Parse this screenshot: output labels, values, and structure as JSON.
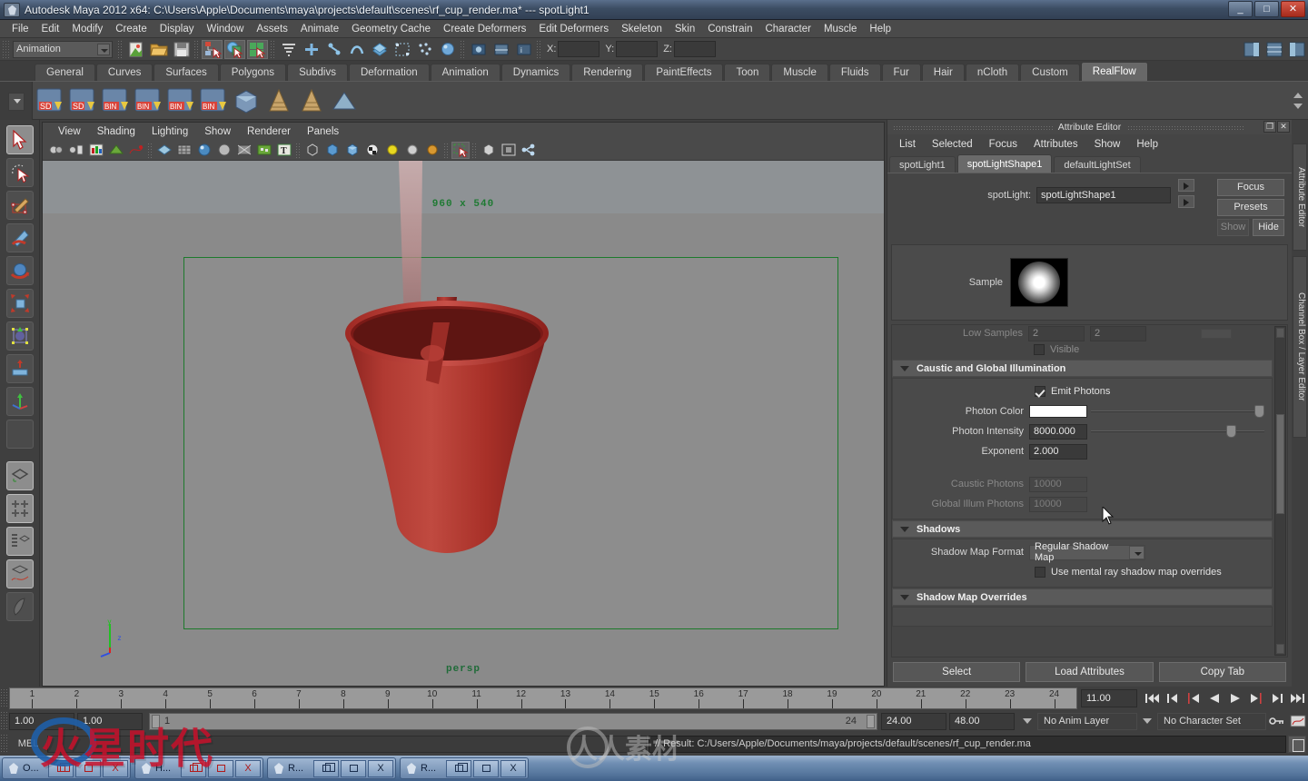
{
  "window": {
    "title": "Autodesk Maya 2012 x64: C:\\Users\\Apple\\Documents\\maya\\projects\\default\\scenes\\rf_cup_render.ma*   ---   spotLight1",
    "minimize": "_",
    "maximize": "□",
    "close": "✕"
  },
  "menubar": [
    "File",
    "Edit",
    "Modify",
    "Create",
    "Display",
    "Window",
    "Assets",
    "Animate",
    "Geometry Cache",
    "Create Deformers",
    "Edit Deformers",
    "Skeleton",
    "Skin",
    "Constrain",
    "Character",
    "Muscle",
    "Help"
  ],
  "statusline": {
    "menu_set": "Animation",
    "coord_x": "X:",
    "coord_y": "Y:",
    "coord_z": "Z:",
    "x_value": "",
    "y_value": "",
    "z_value": ""
  },
  "shelf": {
    "tabs": [
      "General",
      "Curves",
      "Surfaces",
      "Polygons",
      "Subdivs",
      "Deformation",
      "Animation",
      "Dynamics",
      "Rendering",
      "PaintEffects",
      "Toon",
      "Muscle",
      "Fluids",
      "Fur",
      "Hair",
      "nCloth",
      "Custom",
      "RealFlow"
    ],
    "active_tab": "RealFlow",
    "items": [
      "SD",
      "SD",
      "BIN",
      "BIN",
      "BIN",
      "BIN",
      "mesh",
      "emitter",
      "emitter2",
      "mesh2"
    ]
  },
  "viewport": {
    "menus": [
      "View",
      "Shading",
      "Lighting",
      "Show",
      "Renderer",
      "Panels"
    ],
    "resolution_label": "960 x 540",
    "camera_label": "persp",
    "axis": {
      "x": "x",
      "y": "y",
      "z": "z"
    }
  },
  "attribute_editor": {
    "panel_title": "Attribute Editor",
    "menus": [
      "List",
      "Selected",
      "Focus",
      "Attributes",
      "Show",
      "Help"
    ],
    "tabs": [
      "spotLight1",
      "spotLightShape1",
      "defaultLightSet"
    ],
    "active_tab": "spotLightShape1",
    "node_label": "spotLight:",
    "node_value": "spotLightShape1",
    "buttons": {
      "focus": "Focus",
      "presets": "Presets",
      "show": "Show",
      "hide": "Hide"
    },
    "sample_label": "Sample",
    "clipped_row": {
      "label": "Low Samples",
      "value_a": "2",
      "value_b": "2"
    },
    "visible_label": "Visible",
    "sections": {
      "caustic": {
        "title": "Caustic and Global Illumination",
        "emit_photons_label": "Emit Photons",
        "emit_photons_checked": true,
        "photon_color_label": "Photon Color",
        "photon_color_value": "#ffffff",
        "photon_intensity_label": "Photon Intensity",
        "photon_intensity_value": "8000.000",
        "exponent_label": "Exponent",
        "exponent_value": "2.000",
        "caustic_photons_label": "Caustic Photons",
        "caustic_photons_value": "10000",
        "global_illum_label": "Global Illum Photons",
        "global_illum_value": "10000"
      },
      "shadows": {
        "title": "Shadows",
        "shadow_map_format_label": "Shadow Map Format",
        "shadow_map_format_value": "Regular Shadow Map",
        "overrides_checkbox_label": "Use mental ray shadow map overrides",
        "overrides_checked": false
      },
      "shadow_map_overrides": {
        "title": "Shadow Map Overrides"
      }
    },
    "footer": {
      "select": "Select",
      "load_attributes": "Load Attributes",
      "copy_tab": "Copy Tab"
    }
  },
  "right_tabs": [
    "Attribute Editor",
    "Channel Box / Layer Editor"
  ],
  "timeline": {
    "ticks": [
      "1",
      "2",
      "3",
      "4",
      "5",
      "6",
      "7",
      "8",
      "9",
      "10",
      "11",
      "12",
      "13",
      "14",
      "15",
      "16",
      "17",
      "18",
      "19",
      "20",
      "21",
      "22",
      "23",
      "24"
    ],
    "current_frame": "11.00"
  },
  "range": {
    "start": "1.00",
    "end": "1.00",
    "bar_start": "1",
    "bar_end": "24",
    "range_end": "24.00",
    "playback_end": "48.00",
    "anim_layer": "No Anim Layer",
    "character_set": "No Character Set"
  },
  "command_line": {
    "label": "MEL",
    "input_value": "",
    "result": "// Result: C:/Users/Apple/Documents/maya/projects/default/scenes/rf_cup_render.ma"
  },
  "taskbar": {
    "items": [
      {
        "label": "O...",
        "restore": "❐",
        "minimize": "▭",
        "close": "X",
        "active": true
      },
      {
        "label": "H...",
        "restore": "❐",
        "minimize": "▭",
        "close": "X",
        "active": true
      },
      {
        "label": "R...",
        "restore": "❐",
        "minimize": "▭",
        "close": "X",
        "active": false
      },
      {
        "label": "R...",
        "restore": "❐",
        "minimize": "▭",
        "close": "X",
        "active": false
      }
    ]
  },
  "watermarks": {
    "cn_left": "火星时代",
    "cn_right": "人人素材"
  },
  "colors": {
    "accent_green": "#1d7a2c",
    "cup_red": "#b02b28",
    "panel_bg": "#454545",
    "viewport_bg": "#8a8a8a"
  }
}
